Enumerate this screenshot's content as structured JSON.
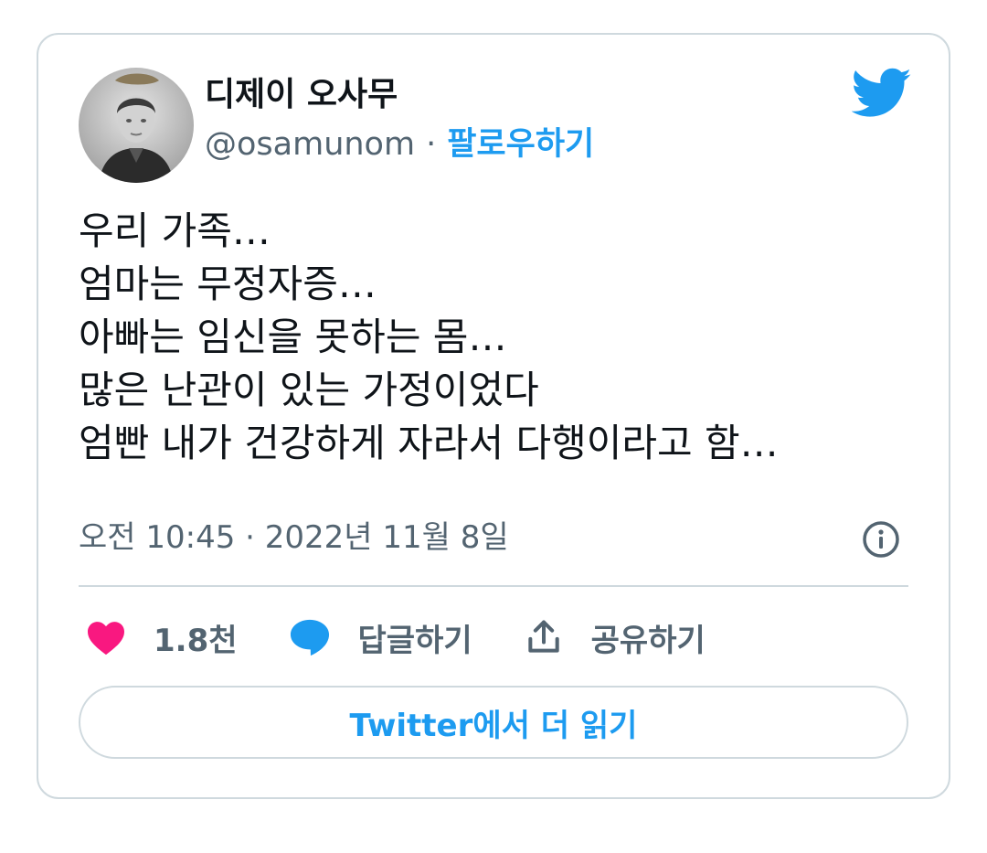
{
  "author": {
    "display_name": "디제이 오사무",
    "handle": "@osamunom",
    "separator": "·",
    "follow_label": "팔로우하기"
  },
  "tweet": {
    "lines": [
      "우리 가족…",
      "엄마는 무정자증…",
      "아빠는 임신을 못하는 몸…",
      "많은 난관이 있는 가정이었다",
      "엄빤 내가 건강하게 자라서 다행이라고 함…"
    ],
    "timestamp": "오전 10:45 · 2022년 11월 8일"
  },
  "actions": {
    "like_count": "1.8천",
    "reply_label": "답글하기",
    "share_label": "공유하기"
  },
  "read_more_label": "Twitter에서 더 읽기",
  "colors": {
    "accent": "#1d9bf0",
    "like": "#f91880",
    "secondary_text": "#536471",
    "border": "#cfd9de"
  },
  "icons": [
    "twitter-bird-icon",
    "info-icon",
    "heart-icon",
    "reply-bubble-icon",
    "share-icon"
  ]
}
